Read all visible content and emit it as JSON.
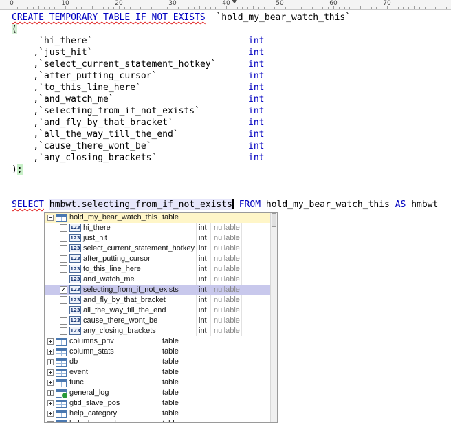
{
  "ruler": {
    "labels": [
      "0",
      "10",
      "20",
      "30",
      "40",
      "50",
      "60",
      "70"
    ]
  },
  "editor": {
    "lines": {
      "create": {
        "kw": "CREATE TEMPORARY TABLE IF NOT EXISTS",
        "table": "`hold_my_bear_watch_this`"
      },
      "open_paren": "(",
      "columns": [
        {
          "prefix": " ",
          "name": "`hi_there`",
          "type": "int"
        },
        {
          "prefix": ",",
          "name": "`just_hit`",
          "type": "int"
        },
        {
          "prefix": ",",
          "name": "`select_current_statement_hotkey`",
          "type": "int"
        },
        {
          "prefix": ",",
          "name": "`after_putting_cursor`",
          "type": "int"
        },
        {
          "prefix": ",",
          "name": "`to_this_line_here`",
          "type": "int"
        },
        {
          "prefix": ",",
          "name": "`and_watch_me`",
          "type": "int"
        },
        {
          "prefix": ",",
          "name": "`selecting_from_if_not_exists`",
          "type": "int"
        },
        {
          "prefix": ",",
          "name": "`and_fly_by_that_bracket`",
          "type": "int"
        },
        {
          "prefix": ",",
          "name": "`all_the_way_till_the_end`",
          "type": "int"
        },
        {
          "prefix": ",",
          "name": "`cause_there_wont_be`",
          "type": "int"
        },
        {
          "prefix": ",",
          "name": "`any_closing_brackets`",
          "type": "int"
        }
      ],
      "close": {
        "paren": ")",
        "semi": ";"
      },
      "select": {
        "kw_select": "SELECT",
        "expr": "hmbwt.selecting_from_if_not_exists",
        "kw_from": "FROM",
        "table": "hold_my_bear_watch_this",
        "kw_as": "AS",
        "alias": "hmbwt"
      }
    }
  },
  "popup": {
    "table": {
      "name": "hold_my_bear_watch_this",
      "kind": "table"
    },
    "columns": [
      {
        "name": "hi_there",
        "type": "int",
        "nullable": "nullable",
        "checked": false
      },
      {
        "name": "just_hit",
        "type": "int",
        "nullable": "nullable",
        "checked": false
      },
      {
        "name": "select_current_statement_hotkey",
        "type": "int",
        "nullable": "nullable",
        "checked": false
      },
      {
        "name": "after_putting_cursor",
        "type": "int",
        "nullable": "nullable",
        "checked": false
      },
      {
        "name": "to_this_line_here",
        "type": "int",
        "nullable": "nullable",
        "checked": false
      },
      {
        "name": "and_watch_me",
        "type": "int",
        "nullable": "nullable",
        "checked": false
      },
      {
        "name": "selecting_from_if_not_exists",
        "type": "int",
        "nullable": "nullable",
        "checked": true
      },
      {
        "name": "and_fly_by_that_bracket",
        "type": "int",
        "nullable": "nullable",
        "checked": false
      },
      {
        "name": "all_the_way_till_the_end",
        "type": "int",
        "nullable": "nullable",
        "checked": false
      },
      {
        "name": "cause_there_wont_be",
        "type": "int",
        "nullable": "nullable",
        "checked": false
      },
      {
        "name": "any_closing_brackets",
        "type": "int",
        "nullable": "nullable",
        "checked": false
      }
    ],
    "col_icon_label": "123",
    "check_mark": "✓",
    "tables": [
      {
        "name": "columns_priv",
        "kind": "table",
        "icon": "table-icon"
      },
      {
        "name": "column_stats",
        "kind": "table",
        "icon": "table-icon"
      },
      {
        "name": "db",
        "kind": "table",
        "icon": "table-icon"
      },
      {
        "name": "event",
        "kind": "table",
        "icon": "table-icon"
      },
      {
        "name": "func",
        "kind": "table",
        "icon": "table-icon"
      },
      {
        "name": "general_log",
        "kind": "table",
        "icon": "log-table-icon"
      },
      {
        "name": "gtid_slave_pos",
        "kind": "table",
        "icon": "table-icon"
      },
      {
        "name": "help_category",
        "kind": "table",
        "icon": "table-icon"
      },
      {
        "name": "help_keyword",
        "kind": "table",
        "icon": "table-icon"
      }
    ]
  }
}
